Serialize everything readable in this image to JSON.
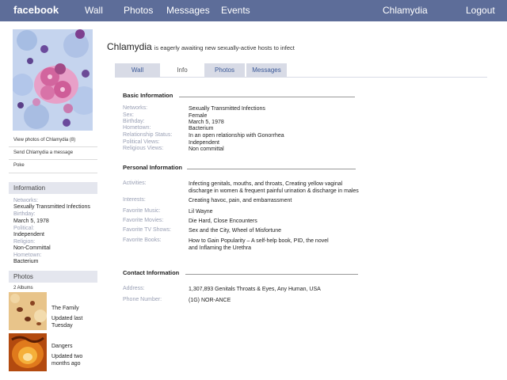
{
  "topbar": {
    "logo": "facebook",
    "nav": [
      "Wall",
      "Photos",
      "Messages",
      "Events"
    ],
    "user": "Chlamydia",
    "logout": "Logout"
  },
  "sidebar": {
    "links": [
      "View photos of Chlamydia (8)",
      "Send Chlamydia a message",
      "Poke"
    ],
    "information_header": "Information",
    "information": [
      {
        "label": "Networks:",
        "value": "Sexually Transmitted Infections"
      },
      {
        "label": "Birthday:",
        "value": "March 5, 1978"
      },
      {
        "label": "Political:",
        "value": "Independent"
      },
      {
        "label": "Religion:",
        "value": "Non-Committal"
      },
      {
        "label": "Hometown:",
        "value": "Bacterium"
      }
    ],
    "photos_header": "Photos",
    "albums_count": "2 Albums",
    "albums": [
      {
        "name": "The Family",
        "updated": "Updated last Tuesday"
      },
      {
        "name": "Dangers",
        "updated": "Updated two months ago"
      }
    ]
  },
  "profile": {
    "name": "Chlamydia",
    "status": "is eagerly awaiting new sexually-active  hosts to infect"
  },
  "tabs": [
    "Wall",
    "Info",
    "Photos",
    "Messages"
  ],
  "active_tab": "Info",
  "basic_info": {
    "title": "Basic Information",
    "rows": [
      {
        "label": "Networks:",
        "value": "Sexually Transmitted Infections"
      },
      {
        "label": "Sex:",
        "value": "Female"
      },
      {
        "label": "Birthday:",
        "value": "March 5, 1978"
      },
      {
        "label": "Hometown:",
        "value": "Bacterium"
      },
      {
        "label": "Relationship Status:",
        "value": "In an open relationship with Gonorrhea"
      },
      {
        "label": "Political Views:",
        "value": "Independent"
      },
      {
        "label": "Religious Views:",
        "value": "Non committal"
      }
    ]
  },
  "personal_info": {
    "title": "Personal Information",
    "rows": [
      {
        "label": "Activities:",
        "value": "Infecting genitals, mouths, and throats, Creating yellow vaginal",
        "value2": "discharge in women & frequent painful urination & discharge in males"
      },
      {
        "label": "Interests:",
        "value": "Creating havoc, pain, and embarrassment"
      },
      {
        "label": "Favorite Music:",
        "value": "Lil Wayne"
      },
      {
        "label": "Favorite Movies:",
        "value": "Die Hard, Close Encounters"
      },
      {
        "label": "Favorite TV Shows:",
        "value": "Sex and the City, Wheel of Misfortune"
      },
      {
        "label": "Favorite Books:",
        "value": "How to Gain Popularity – A self-help book, PID, the novel",
        "value2": " and Inflaming the Urethra"
      }
    ]
  },
  "contact_info": {
    "title": "Contact Information",
    "rows": [
      {
        "label": "Address:",
        "value": "1,307,893 Genitals Throats & Eyes, Any Human, USA"
      },
      {
        "label": "Phone Number:",
        "value": "(1G) NOR-ANCE"
      }
    ]
  },
  "colors": {
    "topbar": "#5d6d99",
    "tab_inactive": "#d8dbe6",
    "header_band": "#e4e6ee",
    "label_gray": "#9aa0b5"
  }
}
